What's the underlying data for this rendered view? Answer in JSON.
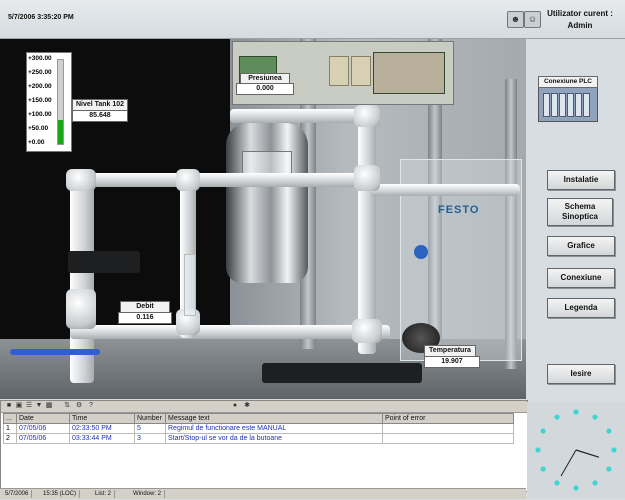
{
  "header": {
    "datetime": "5/7/2006 3:35:20 PM",
    "user_label": "Utilizator curent :",
    "user_name": "Admin"
  },
  "gauge": {
    "ticks": [
      "+300.00",
      "+250.00",
      "+200.00",
      "+150.00",
      "+100.00",
      "+50.00",
      "+0.00"
    ],
    "max": 300,
    "level": 85.648,
    "fill_color": "#1aa51a"
  },
  "process": {
    "tank_level_label": "Nivel Tank 102",
    "tank_level_value": "85.648",
    "pressure_label": "Presiunea",
    "pressure_value": "0.000",
    "flow_label": "Debit",
    "flow_value": "0.116",
    "temperature_label": "Temperatura",
    "temperature_value": "19.907",
    "brand_text": "FESTO"
  },
  "plc": {
    "label": "Conexiune PLC"
  },
  "nav": {
    "instalatie": "Instalatie",
    "schema_line1": "Schema",
    "schema_line2": "Sinoptica",
    "grafice": "Grafice",
    "conexiune": "Conexiune",
    "legenda": "Legenda",
    "iesire": "Iesire"
  },
  "messages": {
    "columns": [
      "...",
      "Date",
      "Time",
      "Number",
      "Message text",
      "Point of error"
    ],
    "rows": [
      {
        "idx": "1",
        "date": "07/05/06",
        "time": "02:33:50 PM",
        "number": "5",
        "text": "Regimul de functionare este MANUAL",
        "point": ""
      },
      {
        "idx": "2",
        "date": "07/05/06",
        "time": "03:33:44 PM",
        "number": "3",
        "text": "Start/Stop-ul se vor da de la butoane",
        "point": ""
      }
    ],
    "toolbar_icons": [
      "ack-icon",
      "ack-all-icon",
      "list-icon",
      "filter-icon",
      "print-icon",
      "sort-icon",
      "config-icon",
      "help-icon",
      "lock-icon",
      "settings-icon"
    ]
  },
  "status_bar": {
    "date": "5/7/2006",
    "time": "15:35 (LOC)",
    "list": "List: 2",
    "window": "Window: 2"
  },
  "clock": {
    "hour": 3,
    "minute": 35,
    "dot_color": "#3fd6d2",
    "hand_color": "#222222"
  }
}
